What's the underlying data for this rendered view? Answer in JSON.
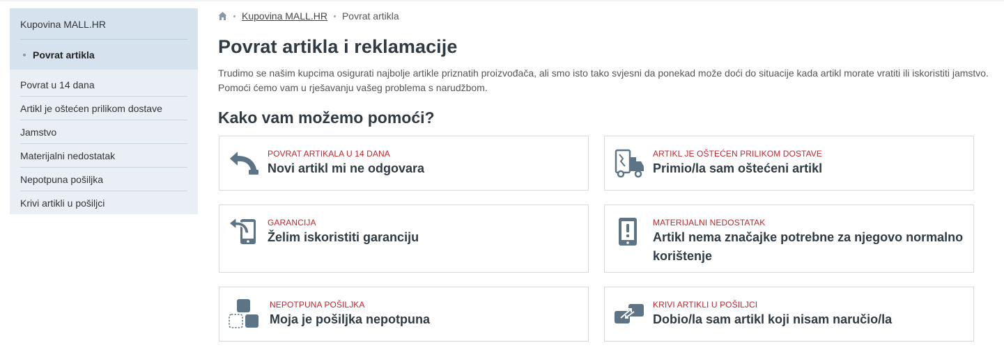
{
  "sidebar": {
    "root": "Kupovina MALL.HR",
    "active": "Povrat artikla",
    "items": [
      "Povrat u 14 dana",
      "Artikl je oštećen prilikom dostave",
      "Jamstvo",
      "Materijalni nedostatak",
      "Nepotpuna pošiljka",
      "Krivi artikli u pošiljci"
    ]
  },
  "breadcrumb": {
    "home_icon": "home-icon",
    "link": "Kupovina MALL.HR",
    "current": "Povrat artikla"
  },
  "page": {
    "title": "Povrat artikla i reklamacije",
    "intro": "Trudimo se našim kupcima osigurati najbolje artikle priznatih proizvođača, ali smo isto tako svjesni da ponekad može doći do situacije kada artikl morate vratiti ili iskoristiti jamstvo. Pomoći ćemo vam u rješavanju vašeg problema s narudžbom.",
    "subtitle": "Kako vam možemo pomoći?"
  },
  "cards": [
    {
      "icon": "return-arrow-icon",
      "category": "POVRAT ARTIKALA U 14 DANA",
      "title": "Novi artikl mi ne odgovara"
    },
    {
      "icon": "damaged-delivery-truck-icon",
      "category": "ARTIKL JE OŠTEĆEN PRILIKOM DOSTAVE",
      "title": "Primio/la sam oštećeni artikl"
    },
    {
      "icon": "phone-return-icon",
      "category": "GARANCIJA",
      "title": "Želim iskoristiti garanciju"
    },
    {
      "icon": "phone-exclamation-icon",
      "category": "MATERIJALNI NEDOSTATAK",
      "title": "Artikl nema značajke potrebne za njegovo normalno korištenje"
    },
    {
      "icon": "missing-package-blocks-icon",
      "category": "NEPOTPUNA POŠILJKA",
      "title": "Moja je pošiljka nepotpuna"
    },
    {
      "icon": "swap-arrows-icon",
      "category": "KRIVI ARTIKLI U POŠILJCI",
      "title": "Dobio/la sam artikl koji nisam naručio/la"
    }
  ],
  "colors": {
    "accent_red": "#c0262d",
    "icon_slate": "#5d7486",
    "sidebar_top": "#d6e3ee",
    "sidebar_list": "#e9eff5",
    "heading": "#2f3a44"
  }
}
